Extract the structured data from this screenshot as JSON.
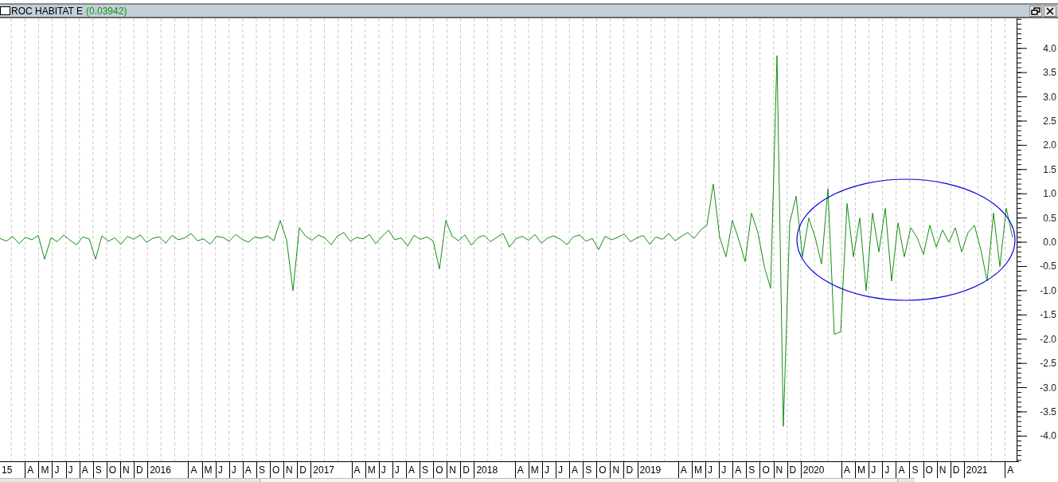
{
  "window": {
    "value": "(0.03942)"
  },
  "chart_data": {
    "type": "line",
    "ylim": [
      -4.52,
      4.62
    ],
    "yticks": [
      {
        "value": 4,
        "label": "4.0"
      },
      {
        "value": 3.5,
        "label": "3.5"
      },
      {
        "value": 3,
        "label": "3.0"
      },
      {
        "value": 2.5,
        "label": "2.5"
      },
      {
        "value": 2,
        "label": "2.0"
      },
      {
        "value": 1.5,
        "label": "1.5"
      },
      {
        "value": 1,
        "label": "1.0"
      },
      {
        "value": 0.5,
        "label": "0.5"
      },
      {
        "value": 0,
        "label": "0.0"
      },
      {
        "value": -0.5,
        "label": "-0.5"
      },
      {
        "value": -1,
        "label": "-1.0"
      },
      {
        "value": -1.5,
        "label": "-1.5"
      },
      {
        "value": -2,
        "label": "-2.0"
      },
      {
        "value": -2.5,
        "label": "-2.5"
      },
      {
        "value": -3,
        "label": "-3.0"
      },
      {
        "value": -3.5,
        "label": "-3.5"
      },
      {
        "value": -4,
        "label": "-4.0"
      }
    ],
    "series": [
      {
        "name": "ROC HABITAT E",
        "color": "#109010",
        "values": [
          0.08,
          0.02,
          0.12,
          -0.03,
          0.1,
          0.05,
          0.14,
          -0.35,
          0.09,
          0.01,
          0.15,
          0.04,
          -0.05,
          0.11,
          0.07,
          -0.35,
          0.13,
          0.02,
          0.09,
          -0.04,
          0.12,
          0.06,
          0.15,
          0.0,
          0.08,
          0.11,
          -0.02,
          0.14,
          0.05,
          0.09,
          0.18,
          0.03,
          0.07,
          -0.04,
          0.12,
          0.1,
          0.02,
          0.16,
          0.06,
          0.0,
          0.11,
          0.08,
          0.13,
          0.03,
          0.45,
          0.05,
          -1.0,
          0.3,
          0.12,
          0.04,
          0.15,
          0.09,
          -0.05,
          0.13,
          0.2,
          0.02,
          0.1,
          0.07,
          0.16,
          -0.03,
          0.12,
          0.25,
          0.05,
          0.09,
          -0.08,
          0.14,
          0.06,
          0.11,
          0.03,
          -0.55,
          0.45,
          0.12,
          0.03,
          0.15,
          -0.06,
          0.09,
          0.14,
          0.01,
          0.1,
          0.18,
          -0.1,
          0.07,
          0.12,
          0.04,
          0.16,
          -0.02,
          0.09,
          0.13,
          0.06,
          -0.05,
          0.11,
          0.15,
          0.02,
          0.08,
          -0.15,
          0.12,
          0.05,
          0.1,
          0.17,
          0.01,
          0.09,
          0.14,
          -0.04,
          0.11,
          0.06,
          0.18,
          0.03,
          0.12,
          0.2,
          0.08,
          0.25,
          0.35,
          1.2,
          0.1,
          -0.3,
          0.45,
          0.05,
          -0.4,
          0.6,
          0.2,
          -0.5,
          -0.95,
          3.85,
          -3.8,
          0.4,
          0.95,
          -0.3,
          0.5,
          0.1,
          -0.45,
          1.1,
          -1.9,
          -1.85,
          0.8,
          -0.3,
          0.5,
          -1.0,
          0.6,
          -0.2,
          0.7,
          -0.8,
          0.4,
          -0.3,
          0.3,
          0.1,
          -0.25,
          0.35,
          -0.1,
          0.25,
          0.0,
          0.3,
          -0.2,
          0.2,
          0.35,
          -0.15,
          -0.8,
          0.6,
          -0.5,
          0.7,
          0.1
        ]
      }
    ]
  },
  "x_axis": {
    "labels": [
      {
        "label": "15",
        "kind": "year"
      },
      {
        "label": "A",
        "kind": "month"
      },
      {
        "label": "M",
        "kind": "month"
      },
      {
        "label": "J",
        "kind": "month"
      },
      {
        "label": "J",
        "kind": "month"
      },
      {
        "label": "A",
        "kind": "month"
      },
      {
        "label": "S",
        "kind": "month"
      },
      {
        "label": "O",
        "kind": "month"
      },
      {
        "label": "N",
        "kind": "month"
      },
      {
        "label": "D",
        "kind": "month"
      },
      {
        "label": "2016",
        "kind": "year"
      },
      {
        "label": "A",
        "kind": "month"
      },
      {
        "label": "M",
        "kind": "month"
      },
      {
        "label": "J",
        "kind": "month"
      },
      {
        "label": "J",
        "kind": "month"
      },
      {
        "label": "A",
        "kind": "month"
      },
      {
        "label": "S",
        "kind": "month"
      },
      {
        "label": "O",
        "kind": "month"
      },
      {
        "label": "N",
        "kind": "month"
      },
      {
        "label": "D",
        "kind": "month"
      },
      {
        "label": "2017",
        "kind": "year"
      },
      {
        "label": "A",
        "kind": "month"
      },
      {
        "label": "M",
        "kind": "month"
      },
      {
        "label": "J",
        "kind": "month"
      },
      {
        "label": "J",
        "kind": "month"
      },
      {
        "label": "A",
        "kind": "month"
      },
      {
        "label": "S",
        "kind": "month"
      },
      {
        "label": "O",
        "kind": "month"
      },
      {
        "label": "N",
        "kind": "month"
      },
      {
        "label": "D",
        "kind": "month"
      },
      {
        "label": "2018",
        "kind": "year"
      },
      {
        "label": "A",
        "kind": "month"
      },
      {
        "label": "M",
        "kind": "month"
      },
      {
        "label": "J",
        "kind": "month"
      },
      {
        "label": "J",
        "kind": "month"
      },
      {
        "label": "A",
        "kind": "month"
      },
      {
        "label": "S",
        "kind": "month"
      },
      {
        "label": "O",
        "kind": "month"
      },
      {
        "label": "N",
        "kind": "month"
      },
      {
        "label": "D",
        "kind": "month"
      },
      {
        "label": "2019",
        "kind": "year"
      },
      {
        "label": "A",
        "kind": "month"
      },
      {
        "label": "M",
        "kind": "month"
      },
      {
        "label": "J",
        "kind": "month"
      },
      {
        "label": "J",
        "kind": "month"
      },
      {
        "label": "A",
        "kind": "month"
      },
      {
        "label": "S",
        "kind": "month"
      },
      {
        "label": "O",
        "kind": "month"
      },
      {
        "label": "N",
        "kind": "month"
      },
      {
        "label": "D",
        "kind": "month"
      },
      {
        "label": "2020",
        "kind": "year"
      },
      {
        "label": "A",
        "kind": "month"
      },
      {
        "label": "M",
        "kind": "month"
      },
      {
        "label": "J",
        "kind": "month"
      },
      {
        "label": "J",
        "kind": "month"
      },
      {
        "label": "A",
        "kind": "month"
      },
      {
        "label": "S",
        "kind": "month"
      },
      {
        "label": "O",
        "kind": "month"
      },
      {
        "label": "N",
        "kind": "month"
      },
      {
        "label": "D",
        "kind": "month"
      },
      {
        "label": "2021",
        "kind": "year"
      },
      {
        "label": "A",
        "kind": "month"
      }
    ]
  }
}
